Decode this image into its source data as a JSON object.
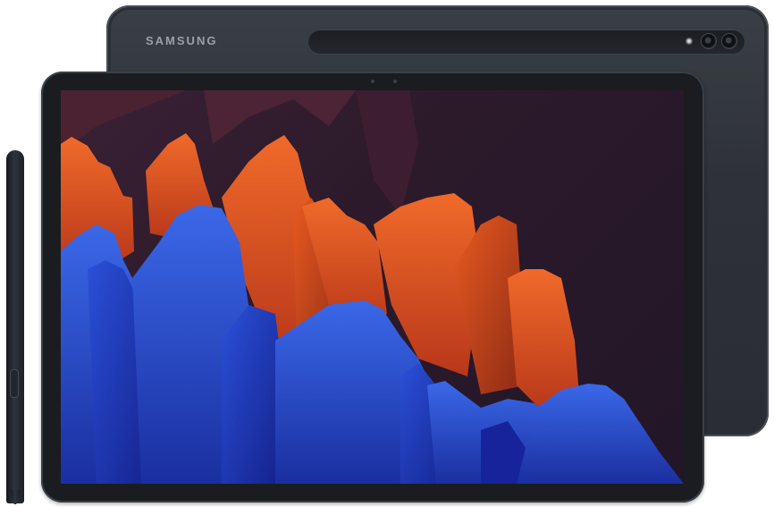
{
  "brand": {
    "logo_text": "SAMSUNG"
  },
  "colors": {
    "body": "#2e3238",
    "bezel": "#1a1c20",
    "wallpaper_bg": "#2c1a2a",
    "orange_peaks": "#e0501f",
    "blue_peaks": "#2f59d6"
  },
  "icons": {
    "camera": "camera-lens-icon",
    "pen": "s-pen-icon"
  }
}
